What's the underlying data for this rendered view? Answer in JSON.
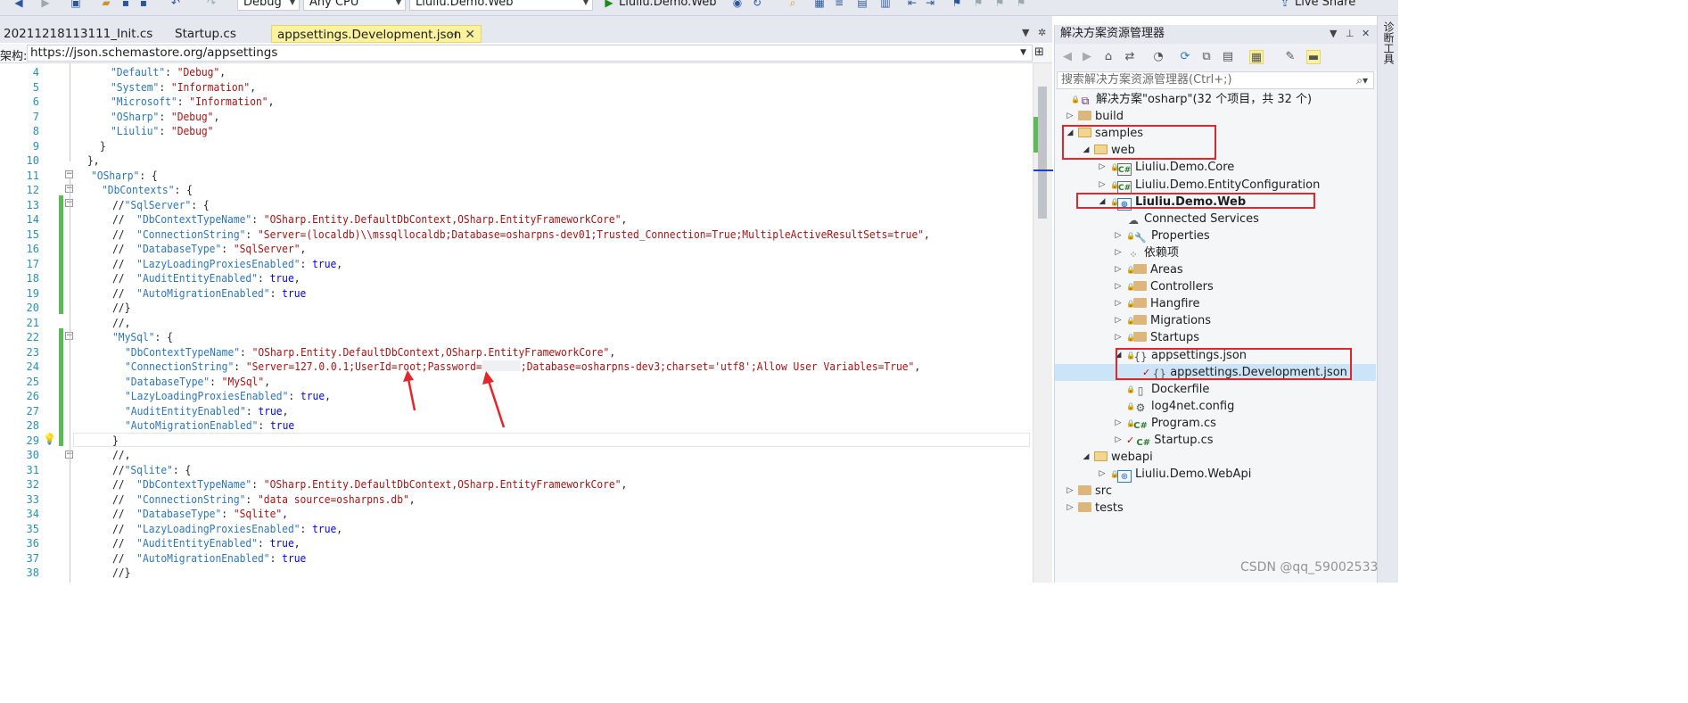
{
  "toolbar": {
    "config": "Debug",
    "platform": "Any CPU",
    "startup_project": "Liuliu.Demo.Web",
    "run_label": "Liuliu.Demo.Web",
    "live_share": "Live Share"
  },
  "tabs": [
    {
      "label": "20211218113111_Init.cs"
    },
    {
      "label": "Startup.cs"
    },
    {
      "label": "appsettings.Development.json",
      "active": true
    }
  ],
  "schema": {
    "label": "架构:",
    "url": "https://json.schemastore.org/appsettings"
  },
  "editor": {
    "lines": [
      {
        "n": "4",
        "text": "\"Default\": \"Debug\","
      },
      {
        "n": "5",
        "text": "\"System\": \"Information\","
      },
      {
        "n": "6",
        "text": "\"Microsoft\": \"Information\","
      },
      {
        "n": "7",
        "text": "\"OSharp\": \"Debug\","
      },
      {
        "n": "8",
        "text": "\"Liuliu\": \"Debug\""
      },
      {
        "n": "9",
        "text": "}"
      },
      {
        "n": "10",
        "text": "},"
      },
      {
        "n": "11",
        "text": "\"OSharp\": {"
      },
      {
        "n": "12",
        "text": "\"DbContexts\": {"
      },
      {
        "n": "13",
        "text": "//\"SqlServer\": {"
      },
      {
        "n": "14",
        "text": "//  \"DbContextTypeName\": \"OSharp.Entity.DefaultDbContext,OSharp.EntityFrameworkCore\","
      },
      {
        "n": "15",
        "text": "//  \"ConnectionString\": \"Server=(localdb)\\\\mssqllocaldb;Database=osharpns-dev01;Trusted_Connection=True;MultipleActiveResultSets=true\","
      },
      {
        "n": "16",
        "text": "//  \"DatabaseType\": \"SqlServer\","
      },
      {
        "n": "17",
        "text": "//  \"LazyLoadingProxiesEnabled\": true,"
      },
      {
        "n": "18",
        "text": "//  \"AuditEntityEnabled\": true,"
      },
      {
        "n": "19",
        "text": "//  \"AutoMigrationEnabled\": true"
      },
      {
        "n": "20",
        "text": "//}"
      },
      {
        "n": "21",
        "text": "//,"
      },
      {
        "n": "22",
        "text": "\"MySql\": {"
      },
      {
        "n": "23",
        "text": "\"DbContextTypeName\": \"OSharp.Entity.DefaultDbContext,OSharp.EntityFrameworkCore\","
      },
      {
        "n": "24",
        "text": "\"ConnectionString\": \"Server=127.0.0.1;UserId=root;Password=      ;Database=osharpns-dev3;charset='utf8';Allow User Variables=True\","
      },
      {
        "n": "25",
        "text": "\"DatabaseType\": \"MySql\","
      },
      {
        "n": "26",
        "text": "\"LazyLoadingProxiesEnabled\": true,"
      },
      {
        "n": "27",
        "text": "\"AuditEntityEnabled\": true,"
      },
      {
        "n": "28",
        "text": "\"AutoMigrationEnabled\": true"
      },
      {
        "n": "29",
        "text": "}"
      },
      {
        "n": "30",
        "text": "//,"
      },
      {
        "n": "31",
        "text": "//\"Sqlite\": {"
      },
      {
        "n": "32",
        "text": "//  \"DbContextTypeName\": \"OSharp.Entity.DefaultDbContext,OSharp.EntityFrameworkCore\","
      },
      {
        "n": "33",
        "text": "//  \"ConnectionString\": \"data source=osharpns.db\","
      },
      {
        "n": "34",
        "text": "//  \"DatabaseType\": \"Sqlite\","
      },
      {
        "n": "35",
        "text": "//  \"LazyLoadingProxiesEnabled\": true,"
      },
      {
        "n": "36",
        "text": "//  \"AuditEntityEnabled\": true,"
      },
      {
        "n": "37",
        "text": "//  \"AutoMigrationEnabled\": true"
      },
      {
        "n": "38",
        "text": "//}"
      }
    ]
  },
  "solution_explorer": {
    "title": "解决方案资源管理器",
    "search_placeholder": "搜索解决方案资源管理器(Ctrl+;)",
    "items": [
      {
        "label": "解决方案\"osharp\"(32 个项目，共 32 个)",
        "icon": "solution-icon"
      },
      {
        "label": "build",
        "icon": "folder-icon"
      },
      {
        "label": "samples",
        "icon": "folder-open-icon"
      },
      {
        "label": "web",
        "icon": "folder-open-icon"
      },
      {
        "label": "Liuliu.Demo.Core",
        "icon": "csharp-project-icon"
      },
      {
        "label": "Liuliu.Demo.EntityConfiguration",
        "icon": "csharp-project-icon"
      },
      {
        "label": "Liuliu.Demo.Web",
        "icon": "web-project-icon"
      },
      {
        "label": "Connected Services",
        "icon": "connected-services-icon"
      },
      {
        "label": "Properties",
        "icon": "wrench-icon"
      },
      {
        "label": "依赖项",
        "icon": "dependencies-icon"
      },
      {
        "label": "Areas",
        "icon": "folder-icon"
      },
      {
        "label": "Controllers",
        "icon": "folder-icon"
      },
      {
        "label": "Hangfire",
        "icon": "folder-icon"
      },
      {
        "label": "Migrations",
        "icon": "folder-icon"
      },
      {
        "label": "Startups",
        "icon": "folder-icon"
      },
      {
        "label": "appsettings.json",
        "icon": "json-file-icon"
      },
      {
        "label": "appsettings.Development.json",
        "icon": "json-file-icon"
      },
      {
        "label": "Dockerfile",
        "icon": "file-icon"
      },
      {
        "label": "log4net.config",
        "icon": "config-file-icon"
      },
      {
        "label": "Program.cs",
        "icon": "csharp-file-icon"
      },
      {
        "label": "Startup.cs",
        "icon": "csharp-file-icon"
      },
      {
        "label": "webapi",
        "icon": "folder-open-icon"
      },
      {
        "label": "Liuliu.Demo.WebApi",
        "icon": "web-project-icon"
      },
      {
        "label": "src",
        "icon": "folder-icon"
      },
      {
        "label": "tests",
        "icon": "folder-icon"
      }
    ]
  },
  "diagnostics_label": "诊断工具",
  "watermark": "CSDN @qq_59002533",
  "colors": {
    "key": "#2e75b6",
    "string": "#a31515",
    "keyword": "#0000ff",
    "line_number": "#2b91af",
    "change_bar": "#5dbb57",
    "annotation_red": "#e3262b",
    "active_tab": "#fbf29f"
  }
}
